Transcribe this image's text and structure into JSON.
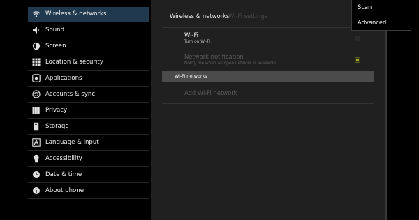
{
  "sidebar": {
    "items": [
      {
        "label": "Wireless & networks",
        "icon": "wifi-icon",
        "selected": true
      },
      {
        "label": "Sound",
        "icon": "speaker-icon"
      },
      {
        "label": "Screen",
        "icon": "brightness-icon"
      },
      {
        "label": "Location & security",
        "icon": "grid-icon"
      },
      {
        "label": "Applications",
        "icon": "apps-icon"
      },
      {
        "label": "Accounts & sync",
        "icon": "sync-icon"
      },
      {
        "label": "Privacy",
        "icon": "privacy-icon"
      },
      {
        "label": "Storage",
        "icon": "sd-card-icon"
      },
      {
        "label": "Language & input",
        "icon": "language-icon"
      },
      {
        "label": "Accessibility",
        "icon": "accessibility-icon"
      },
      {
        "label": "Date & time",
        "icon": "clock-icon"
      },
      {
        "label": "About phone",
        "icon": "info-icon"
      }
    ]
  },
  "panel": {
    "breadcrumb_current": "Wireless & networks",
    "breadcrumb_sub": "Wi-Fi settings",
    "wifi": {
      "title": "Wi-Fi",
      "summary": "Turn on Wi-Fi",
      "checked": false
    },
    "network_notification": {
      "title": "Network notification",
      "summary": "Notify me when an open network is available",
      "checked": true,
      "enabled": false
    },
    "section_header": "Wi-Fi networks",
    "add_network": "Add Wi-Fi network"
  },
  "menu": {
    "items": [
      "Scan",
      "Advanced"
    ]
  },
  "colors": {
    "selected_bg": "#21394f",
    "panel_bg": "#202020",
    "section_header_bg": "#4b4b4b",
    "checkbox_accent": "#a5b21e"
  }
}
